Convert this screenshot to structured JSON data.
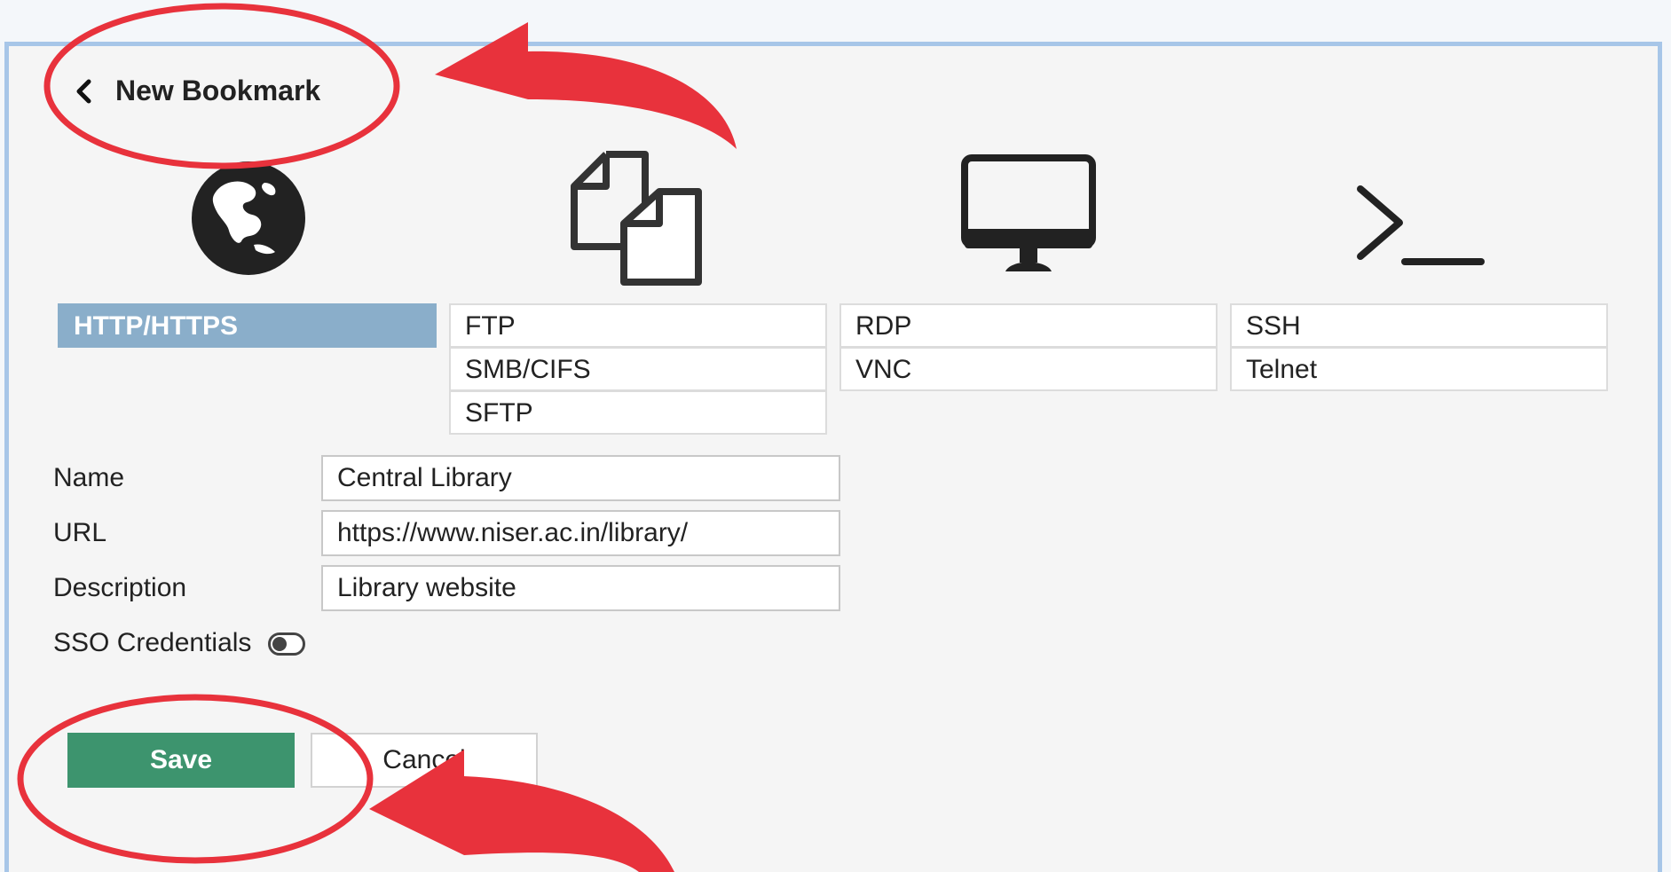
{
  "header": {
    "title": "New Bookmark"
  },
  "types": {
    "http": [
      "HTTP/HTTPS"
    ],
    "file": [
      "FTP",
      "SMB/CIFS",
      "SFTP"
    ],
    "desktop": [
      "RDP",
      "VNC"
    ],
    "terminal": [
      "SSH",
      "Telnet"
    ]
  },
  "icons": {
    "http": "globe-icon",
    "file": "files-icon",
    "desktop": "monitor-icon",
    "terminal": "terminal-icon",
    "back": "chevron-left-icon"
  },
  "form": {
    "name_label": "Name",
    "name_value": "Central Library",
    "url_label": "URL",
    "url_value": "https://www.niser.ac.in/library/",
    "desc_label": "Description",
    "desc_value": "Library website",
    "sso_label": "SSO Credentials",
    "sso_enabled": false
  },
  "buttons": {
    "save": "Save",
    "cancel": "Cancel"
  },
  "colors": {
    "selected": "#8aaeca",
    "save": "#3d946e",
    "annotation": "#e8323c",
    "panel_border": "#a7c6e8"
  }
}
